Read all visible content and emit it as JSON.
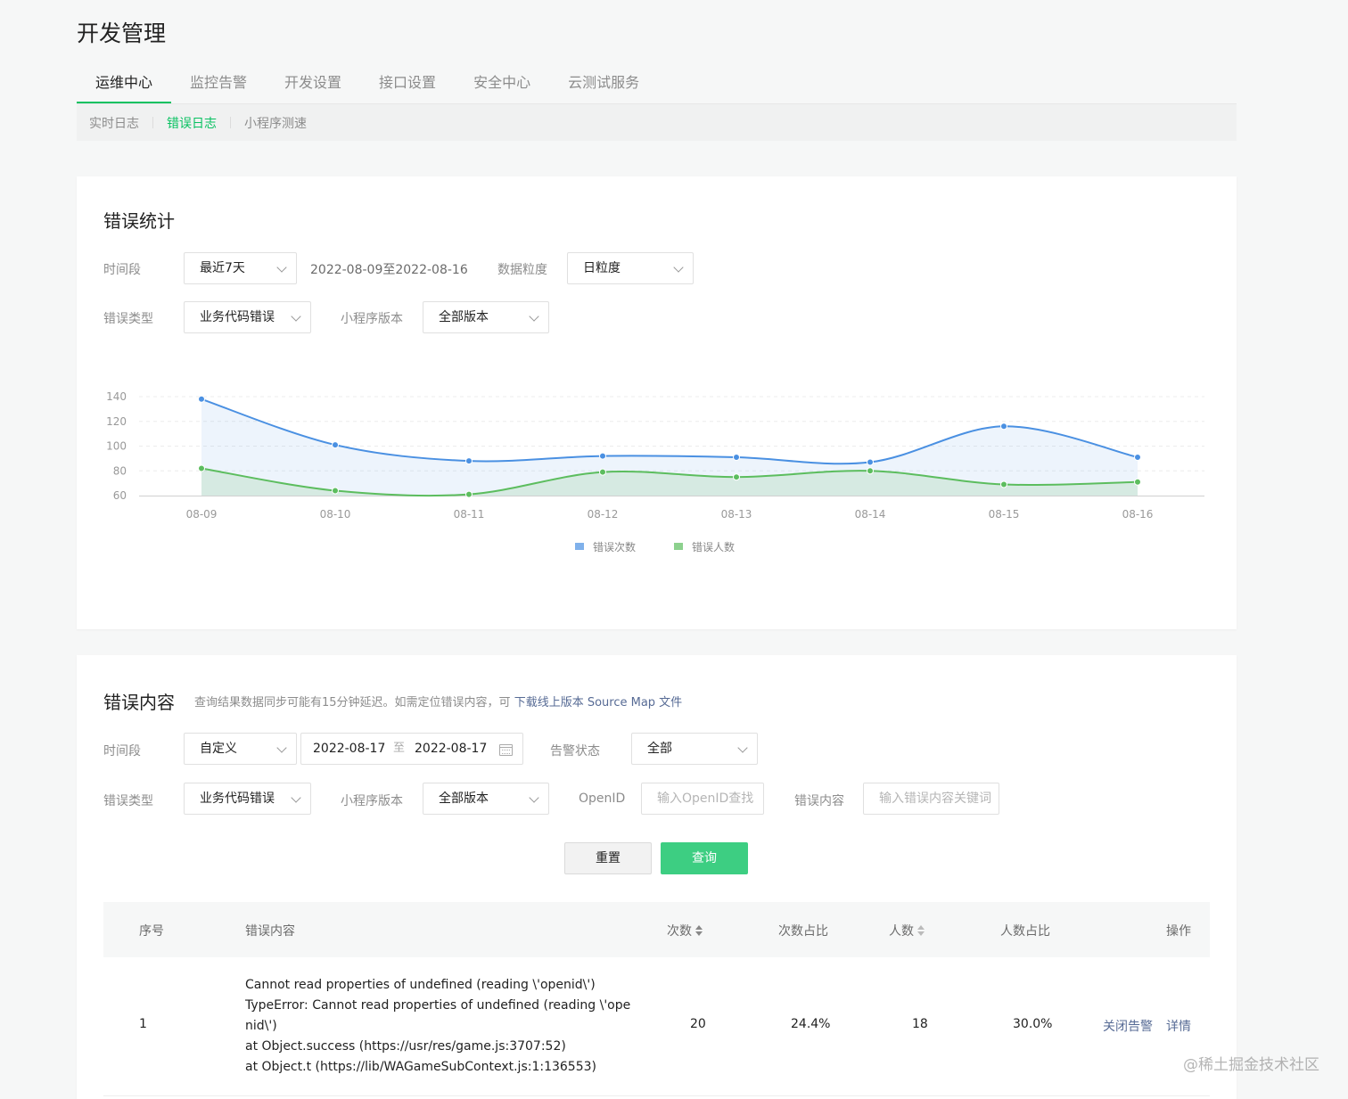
{
  "page": {
    "title": "开发管理"
  },
  "main_tabs": [
    {
      "label": "运维中心",
      "active": true
    },
    {
      "label": "监控告警",
      "active": false
    },
    {
      "label": "开发设置",
      "active": false
    },
    {
      "label": "接口设置",
      "active": false
    },
    {
      "label": "安全中心",
      "active": false
    },
    {
      "label": "云测试服务",
      "active": false
    }
  ],
  "sub_tabs": [
    {
      "label": "实时日志",
      "active": false
    },
    {
      "label": "错误日志",
      "active": true
    },
    {
      "label": "小程序测速",
      "active": false
    }
  ],
  "stats": {
    "title": "错误统计",
    "period_label": "时间段",
    "period_value": "最近7天",
    "date_range": "2022-08-09至2022-08-16",
    "granularity_label": "数据粒度",
    "granularity_value": "日粒度",
    "error_type_label": "错误类型",
    "error_type_value": "业务代码错误",
    "version_label": "小程序版本",
    "version_value": "全部版本"
  },
  "chart_data": {
    "type": "area",
    "categories": [
      "08-09",
      "08-10",
      "08-11",
      "08-12",
      "08-13",
      "08-14",
      "08-15",
      "08-16"
    ],
    "y_ticks": [
      "60",
      "80",
      "100",
      "120",
      "140"
    ],
    "ylim": [
      60,
      140
    ],
    "grid": true,
    "legend_position": "bottom",
    "series": [
      {
        "name": "错误次数",
        "values": [
          138,
          101,
          88,
          92,
          91,
          87,
          116,
          91
        ],
        "color": "#4a90e2"
      },
      {
        "name": "错误人数",
        "values": [
          82,
          64,
          61,
          79,
          75,
          80,
          69,
          71
        ],
        "color": "#5cbd5e"
      }
    ]
  },
  "content": {
    "title": "错误内容",
    "hint_text": "查询结果数据同步可能有15分钟延迟。如需定位错误内容，可",
    "hint_link": "下载线上版本 Source Map 文件",
    "period_label": "时间段",
    "period_value": "自定义",
    "date_start": "2022-08-17",
    "date_to": "至",
    "date_end": "2022-08-17",
    "alert_label": "告警状态",
    "alert_value": "全部",
    "error_type_label": "错误类型",
    "error_type_value": "业务代码错误",
    "version_label": "小程序版本",
    "version_value": "全部版本",
    "openid_label": "OpenID",
    "openid_placeholder": "输入OpenID查找",
    "keyword_label": "错误内容",
    "keyword_placeholder": "输入错误内容关键词",
    "reset_label": "重置",
    "query_label": "查询"
  },
  "table": {
    "headers": {
      "index": "序号",
      "content": "错误内容",
      "count": "次数",
      "count_ratio": "次数占比",
      "users": "人数",
      "user_ratio": "人数占比",
      "actions": "操作"
    },
    "rows": [
      {
        "index": "1",
        "lines": [
          "Cannot read properties of undefined (reading \\'openid\\')",
          "TypeError: Cannot read properties of undefined (reading \\'ope",
          "nid\\')",
          "at Object.success (https://usr/res/game.js:3707:52)",
          "at Object.t (https://lib/WAGameSubContext.js:1:136553)"
        ],
        "count": "20",
        "count_ratio": "24.4%",
        "users": "18",
        "user_ratio": "30.0%",
        "action_close": "关闭告警",
        "action_detail": "详情"
      }
    ]
  },
  "watermark": "@稀土掘金技术社区"
}
